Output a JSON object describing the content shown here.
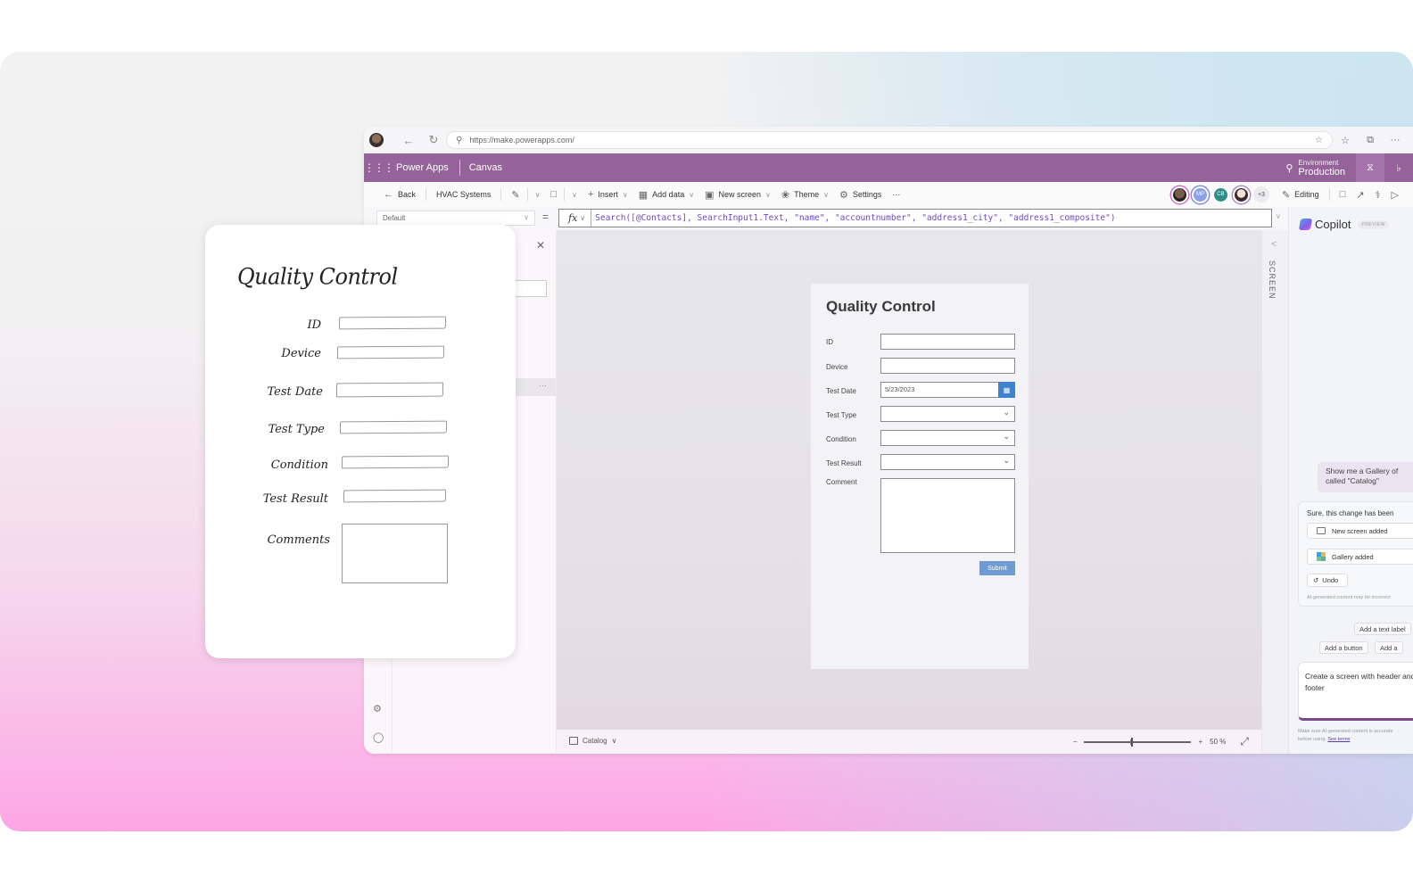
{
  "browser": {
    "url": "https://make.powerapps.com/",
    "nav": {
      "back_icon": "back-arrow-icon",
      "refresh_icon": "refresh-icon"
    },
    "right_icons": [
      "favorite-add-icon",
      "favorites-icon",
      "collections-icon",
      "more-icon"
    ]
  },
  "appbar": {
    "app_name": "Power Apps",
    "section": "Canvas",
    "environment_label": "Environment",
    "environment_value": "Production"
  },
  "cmdbar": {
    "back": "Back",
    "app_title": "HVAC Systems",
    "insert": "Insert",
    "add_data": "Add data",
    "new_screen": "New screen",
    "theme": "Theme",
    "settings": "Settings",
    "more": "···",
    "collaborators": [
      {
        "initials": "",
        "type": "photo"
      },
      {
        "initials": "MP",
        "type": "initials"
      },
      {
        "initials": "CB",
        "type": "initials"
      },
      {
        "initials": "",
        "type": "photo"
      }
    ],
    "more_collaborators": "+3",
    "editing": "Editing"
  },
  "formula_bar": {
    "property": "Default",
    "fx": "fx",
    "formula": "Search([@Contacts], SearchInput1.Text, \"name\", \"accountnumber\", \"address1_city\", \"address1_composite\")"
  },
  "form": {
    "title": "Quality Control",
    "fields": [
      {
        "label": "ID",
        "type": "text",
        "value": ""
      },
      {
        "label": "Device",
        "type": "text",
        "value": ""
      },
      {
        "label": "Test Date",
        "type": "date",
        "value": "5/23/2023"
      },
      {
        "label": "Test Type",
        "type": "dropdown",
        "value": ""
      },
      {
        "label": "Condition",
        "type": "dropdown",
        "value": ""
      },
      {
        "label": "Test Result",
        "type": "dropdown",
        "value": ""
      },
      {
        "label": "Comment",
        "type": "textarea",
        "value": ""
      }
    ],
    "submit": "Submit"
  },
  "screen_panel": {
    "label": "SCREEN"
  },
  "statusbar": {
    "screen_name": "Catalog",
    "zoom_minus": "−",
    "zoom_plus": "+",
    "zoom_percent": "50 %",
    "zoom_value": 50
  },
  "copilot": {
    "title": "Copilot",
    "badge": "PREVIEW",
    "user_message": "Show me a Gallery of called \"Catalog\"",
    "response_text": "Sure, this change has been",
    "chips": [
      "New screen added",
      "Gallery added"
    ],
    "undo": "Undo",
    "disclaimer": "AI-generated content may be incorrect",
    "suggestions": [
      "Add a text label",
      "Add a button",
      "Add a"
    ],
    "prompt_text": "Create a screen with header and footer",
    "terms_line1": "Make sure AI-generated content is accurate",
    "terms_line2": "before using.",
    "terms_link": "See terms"
  },
  "sketch": {
    "title": "Quality Control",
    "labels": [
      "ID",
      "Device",
      "Test Date",
      "Test Type",
      "Condition",
      "Test Result",
      "Comments"
    ]
  }
}
